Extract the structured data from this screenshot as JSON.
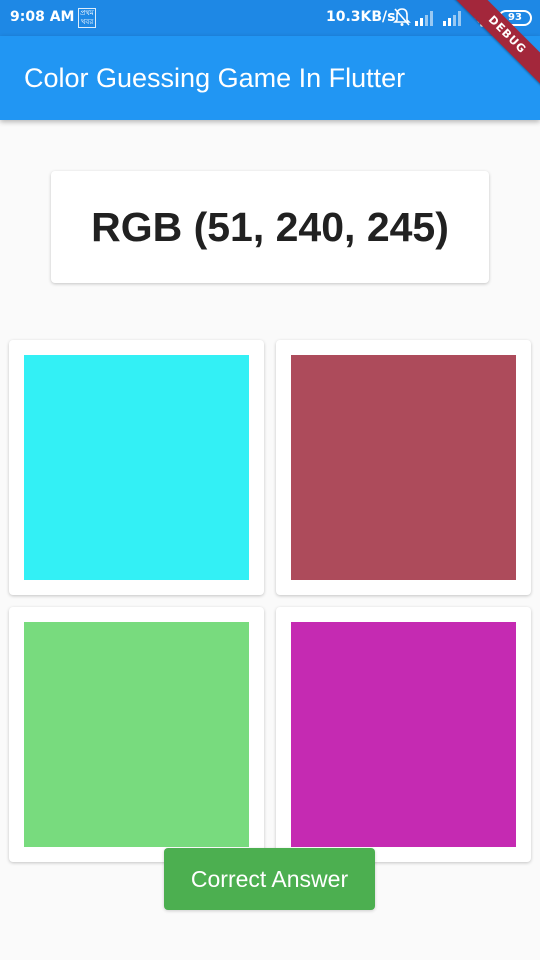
{
  "status_bar": {
    "time": "9:08 AM",
    "carrier_badge": "প্রথম খবর",
    "net_speed": "10.3KB/s",
    "battery": "93",
    "icons": [
      "mute-icon",
      "signal-icon",
      "signal-icon",
      "wifi-icon",
      "battery-icon"
    ]
  },
  "debug_banner": "DEBUG",
  "app_bar": {
    "title": "Color Guessing Game In Flutter"
  },
  "question": {
    "rgb_text": "RGB (51, 240, 245)"
  },
  "options": [
    {
      "color": "#33f0f5"
    },
    {
      "color": "#ad4b5b"
    },
    {
      "color": "#78db7e"
    },
    {
      "color": "#c52ab2"
    }
  ],
  "answer_button": {
    "label": "Correct Answer",
    "color": "#4caf50"
  },
  "colors": {
    "status_bar": "#1e88e5",
    "app_bar": "#2196f3",
    "background": "#fafafa"
  }
}
